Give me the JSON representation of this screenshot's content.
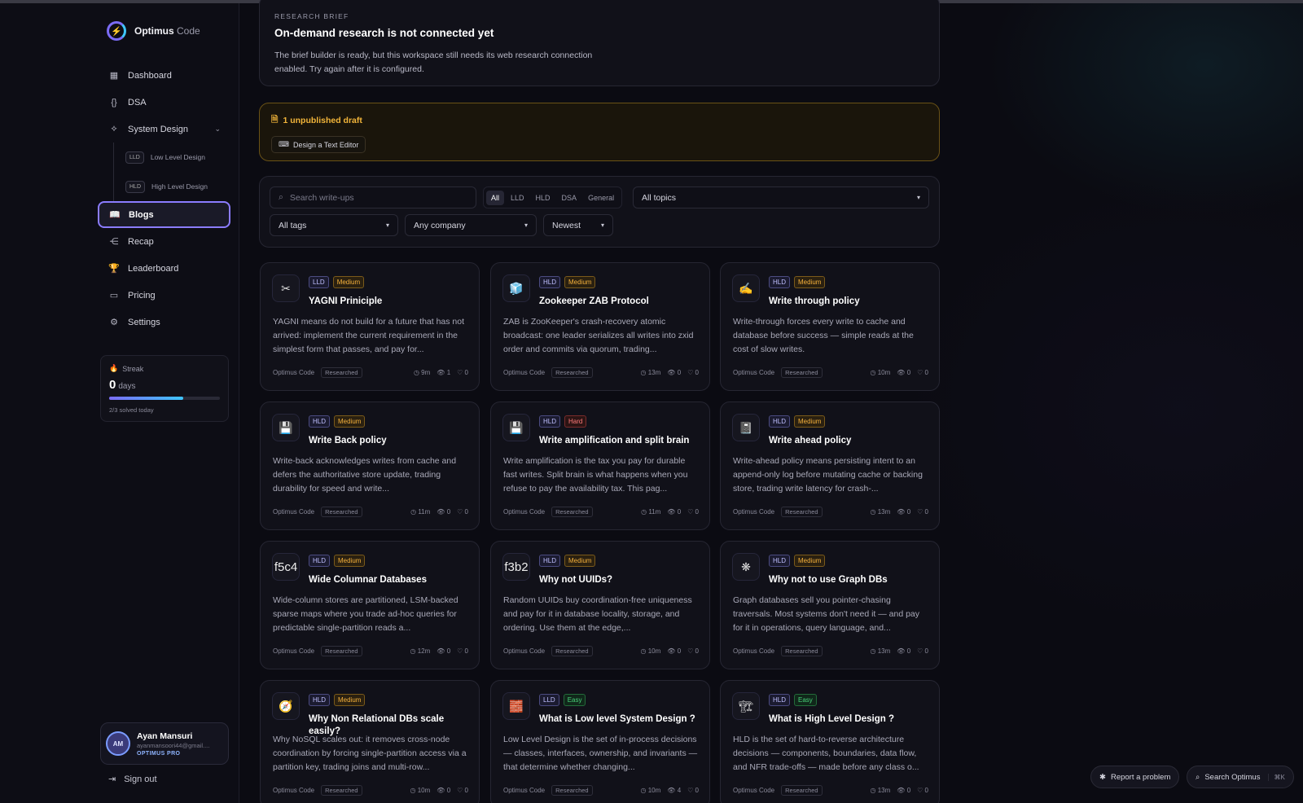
{
  "brand": {
    "name": "Optimus",
    "suffix": "Code",
    "logo_icon": "bolt-ring-icon"
  },
  "nav": {
    "dashboard": "Dashboard",
    "dsa": "DSA",
    "system_design": "System Design",
    "lld": {
      "badge": "LLD",
      "label": "Low Level Design"
    },
    "hld": {
      "badge": "HLD",
      "label": "High Level Design"
    },
    "blogs": "Blogs",
    "recap": "Recap",
    "leaderboard": "Leaderboard",
    "pricing": "Pricing",
    "settings": "Settings"
  },
  "streak": {
    "label": "Streak",
    "value": "0",
    "unit": "days",
    "progress": 0.67,
    "sub": "2/3 solved today"
  },
  "user": {
    "initials": "AM",
    "name": "Ayan Mansuri",
    "email": "ayanmansoori44@gmail....",
    "plan": "OPTIMUS PRO",
    "signout": "Sign out"
  },
  "brief": {
    "kicker": "RESEARCH BRIEF",
    "title": "On-demand research is not connected yet",
    "text": "The brief builder is ready, but this workspace still needs its web research connection enabled. Try again after it is configured."
  },
  "draft": {
    "title": "1 unpublished draft",
    "item": "Design a Text Editor"
  },
  "filters": {
    "search_placeholder": "Search write-ups",
    "segments": [
      "All",
      "LLD",
      "HLD",
      "DSA",
      "General"
    ],
    "topics": "All topics",
    "tags": "All tags",
    "company": "Any company",
    "sort": "Newest"
  },
  "posts": [
    {
      "icon": "✂",
      "kind": "LLD",
      "level": "Medium",
      "title": "YAGNI Priniciple",
      "desc": "YAGNI means do not build for a future that has not arrived: implement the current requirement in the simplest form that passes, and pay for...",
      "author": "Optimus Code",
      "badge": "Researched",
      "time": "9m",
      "views": "1",
      "likes": "0"
    },
    {
      "icon": "🧊",
      "kind": "HLD",
      "level": "Medium",
      "title": "Zookeeper ZAB Protocol",
      "desc": "ZAB is ZooKeeper's crash-recovery atomic broadcast: one leader serializes all writes into zxid order and commits via quorum, trading...",
      "author": "Optimus Code",
      "badge": "Researched",
      "time": "13m",
      "views": "0",
      "likes": "0"
    },
    {
      "icon": "✍",
      "kind": "HLD",
      "level": "Medium",
      "title": "Write through policy",
      "desc": "Write-through forces every write to cache and database before success — simple reads at the cost of slow writes.",
      "author": "Optimus Code",
      "badge": "Researched",
      "time": "10m",
      "views": "0",
      "likes": "0"
    },
    {
      "icon": "💾",
      "kind": "HLD",
      "level": "Medium",
      "title": "Write Back policy",
      "desc": "Write-back acknowledges writes from cache and defers the authoritative store update, trading durability for speed and write...",
      "author": "Optimus Code",
      "badge": "Researched",
      "time": "11m",
      "views": "0",
      "likes": "0"
    },
    {
      "icon": "💾",
      "kind": "HLD",
      "level": "Hard",
      "title": "Write amplification and split brain",
      "desc": "Write amplification is the tax you pay for durable fast writes. Split brain is what happens when you refuse to pay the availability tax. This pag...",
      "author": "Optimus Code",
      "badge": "Researched",
      "time": "11m",
      "views": "0",
      "likes": "0"
    },
    {
      "icon": "📓",
      "kind": "HLD",
      "level": "Medium",
      "title": "Write ahead policy",
      "desc": "Write-ahead policy means persisting intent to an append-only log before mutating cache or backing store, trading write latency for crash-...",
      "author": "Optimus Code",
      "badge": "Researched",
      "time": "13m",
      "views": "0",
      "likes": "0"
    },
    {
      "icon": "f5c4",
      "kind": "HLD",
      "level": "Medium",
      "title": "Wide Columnar Databases",
      "desc": "Wide-column stores are partitioned, LSM-backed sparse maps where you trade ad-hoc queries for predictable single-partition reads a...",
      "author": "Optimus Code",
      "badge": "Researched",
      "time": "12m",
      "views": "0",
      "likes": "0"
    },
    {
      "icon": "f3b2",
      "kind": "HLD",
      "level": "Medium",
      "title": "Why not UUIDs?",
      "desc": "Random UUIDs buy coordination-free uniqueness and pay for it in database locality, storage, and ordering. Use them at the edge,...",
      "author": "Optimus Code",
      "badge": "Researched",
      "time": "10m",
      "views": "0",
      "likes": "0"
    },
    {
      "icon": "❋",
      "kind": "HLD",
      "level": "Medium",
      "title": "Why not to use Graph DBs",
      "desc": "Graph databases sell you pointer-chasing traversals. Most systems don't need it — and pay for it in operations, query language, and...",
      "author": "Optimus Code",
      "badge": "Researched",
      "time": "13m",
      "views": "0",
      "likes": "0"
    },
    {
      "icon": "🧭",
      "kind": "HLD",
      "level": "Medium",
      "title": "Why Non Relational DBs scale easily?",
      "desc": "Why NoSQL scales out: it removes cross-node coordination by forcing single-partition access via a partition key, trading joins and multi-row...",
      "author": "Optimus Code",
      "badge": "Researched",
      "time": "10m",
      "views": "0",
      "likes": "0"
    },
    {
      "icon": "🧱",
      "kind": "LLD",
      "level": "Easy",
      "title": "What is Low level System Design ?",
      "desc": "Low Level Design is the set of in-process decisions — classes, interfaces, ownership, and invariants — that determine whether changing...",
      "author": "Optimus Code",
      "badge": "Researched",
      "time": "10m",
      "views": "4",
      "likes": "0"
    },
    {
      "icon": "🏗",
      "kind": "HLD",
      "level": "Easy",
      "title": "What is High Level Design ?",
      "desc": "HLD is the set of hard-to-reverse architecture decisions — components, boundaries, data flow, and NFR trade-offs — made before any class o...",
      "author": "Optimus Code",
      "badge": "Researched",
      "time": "13m",
      "views": "0",
      "likes": "0"
    }
  ],
  "floating": {
    "report": "Report a problem",
    "search": "Search Optimus",
    "shortcut": "⌘K"
  }
}
